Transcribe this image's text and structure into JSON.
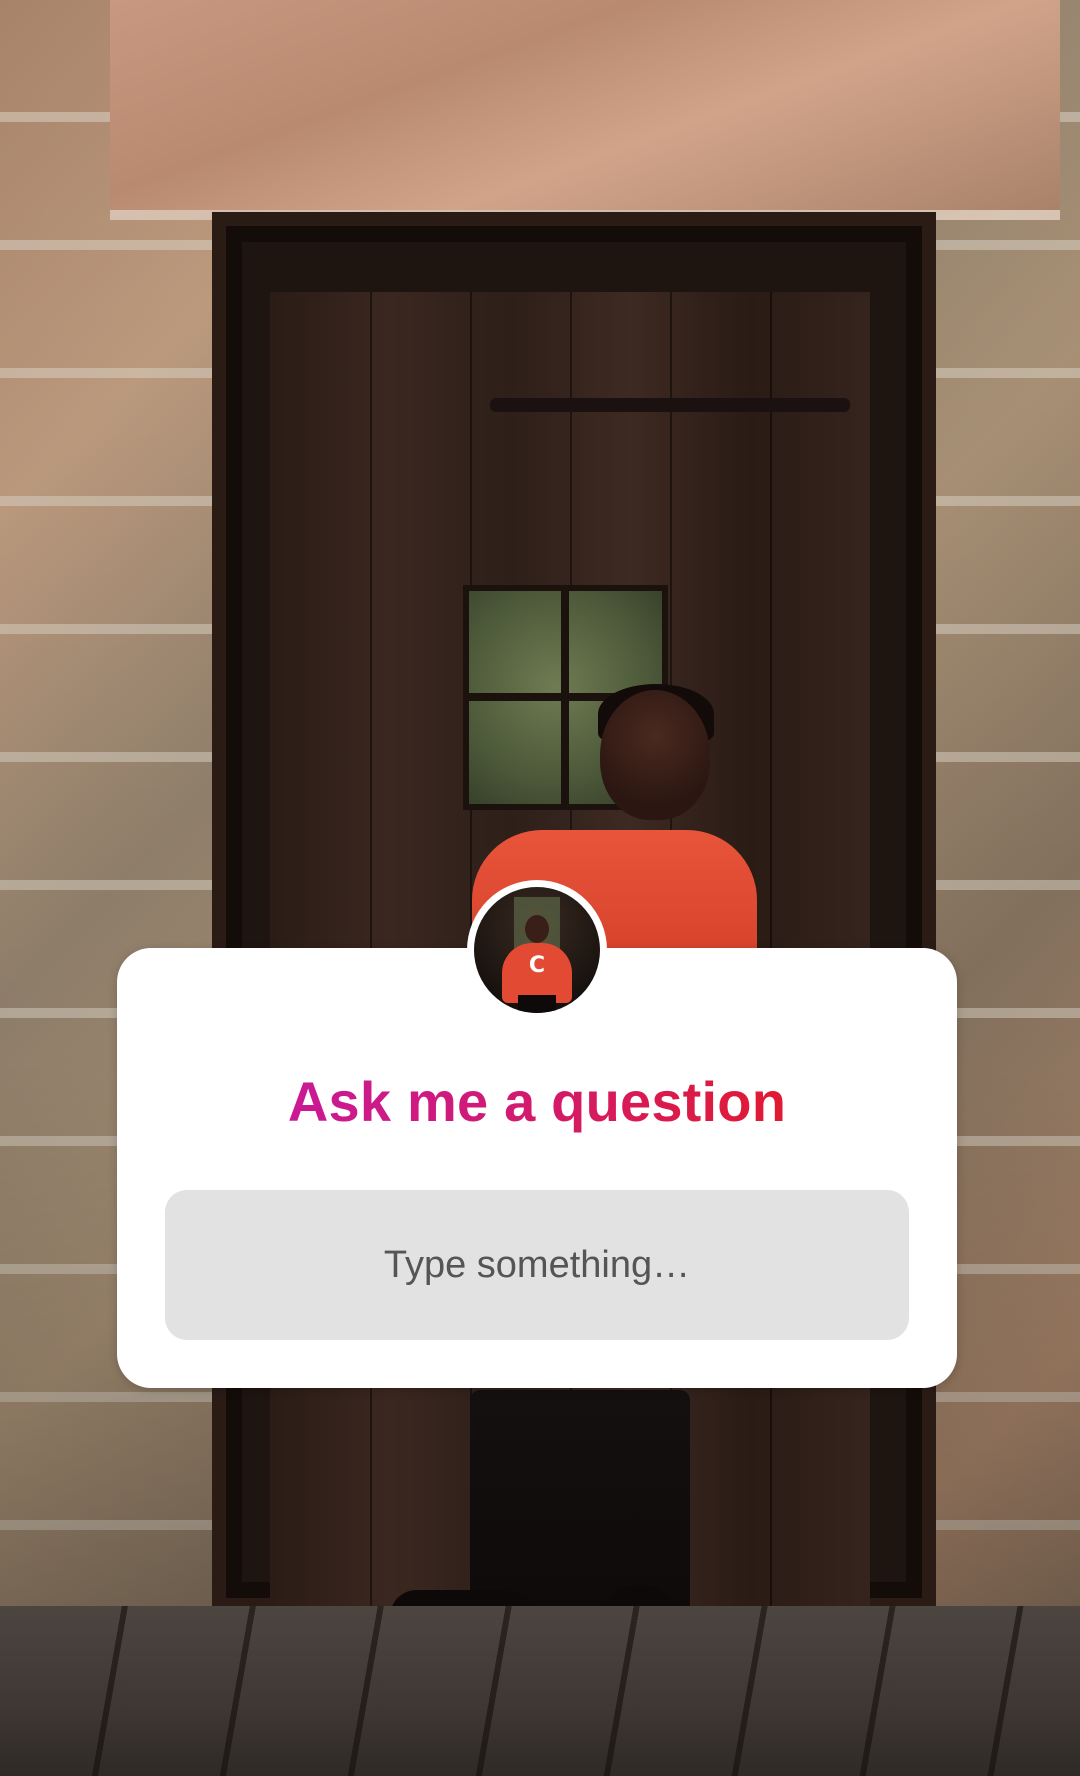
{
  "sticker": {
    "title": "Ask me a question",
    "input_placeholder": "Type something…",
    "avatar_shirt_letter": "C"
  },
  "colors": {
    "title_gradient_start": "#c018c0",
    "title_gradient_end": "#e0161c",
    "input_background": "#e2e2e2",
    "sticker_background": "#ffffff"
  },
  "icons": {
    "avatar": "profile-photo"
  }
}
